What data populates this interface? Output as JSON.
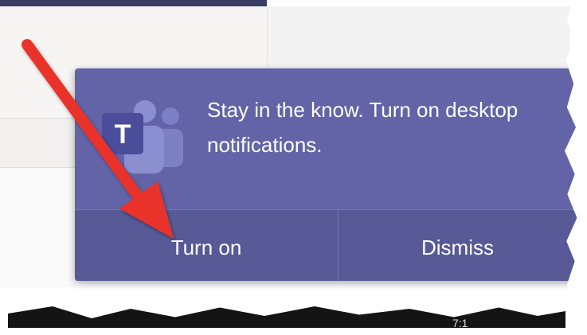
{
  "toast": {
    "message": "Stay in the know. Turn on desktop notifications.",
    "logo_icon": "microsoft-teams-icon",
    "logo_letter": "T",
    "actions": {
      "turn_on_label": "Turn on",
      "dismiss_label": "Dismiss"
    }
  },
  "taskbar": {
    "time_fragment": "7:1"
  },
  "colors": {
    "toast_background": "#6264a7",
    "action_bar": "#575a97",
    "arrow": "#e8322b"
  },
  "annotation": {
    "icon": "red-arrow-icon"
  }
}
